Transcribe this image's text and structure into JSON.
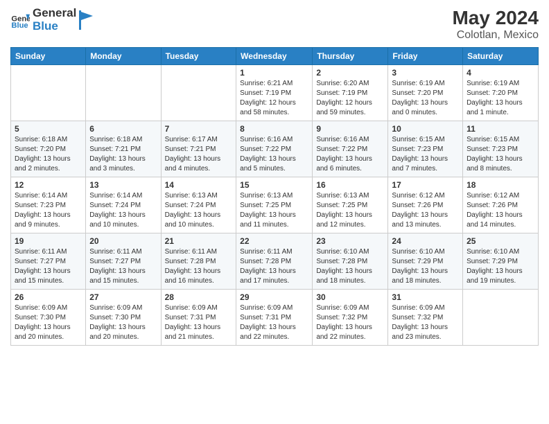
{
  "header": {
    "logo_general": "General",
    "logo_blue": "Blue",
    "month_year": "May 2024",
    "location": "Colotlan, Mexico"
  },
  "days_of_week": [
    "Sunday",
    "Monday",
    "Tuesday",
    "Wednesday",
    "Thursday",
    "Friday",
    "Saturday"
  ],
  "weeks": [
    [
      {
        "day": "",
        "info": ""
      },
      {
        "day": "",
        "info": ""
      },
      {
        "day": "",
        "info": ""
      },
      {
        "day": "1",
        "info": "Sunrise: 6:21 AM\nSunset: 7:19 PM\nDaylight: 12 hours and 58 minutes."
      },
      {
        "day": "2",
        "info": "Sunrise: 6:20 AM\nSunset: 7:19 PM\nDaylight: 12 hours and 59 minutes."
      },
      {
        "day": "3",
        "info": "Sunrise: 6:19 AM\nSunset: 7:20 PM\nDaylight: 13 hours and 0 minutes."
      },
      {
        "day": "4",
        "info": "Sunrise: 6:19 AM\nSunset: 7:20 PM\nDaylight: 13 hours and 1 minute."
      }
    ],
    [
      {
        "day": "5",
        "info": "Sunrise: 6:18 AM\nSunset: 7:20 PM\nDaylight: 13 hours and 2 minutes."
      },
      {
        "day": "6",
        "info": "Sunrise: 6:18 AM\nSunset: 7:21 PM\nDaylight: 13 hours and 3 minutes."
      },
      {
        "day": "7",
        "info": "Sunrise: 6:17 AM\nSunset: 7:21 PM\nDaylight: 13 hours and 4 minutes."
      },
      {
        "day": "8",
        "info": "Sunrise: 6:16 AM\nSunset: 7:22 PM\nDaylight: 13 hours and 5 minutes."
      },
      {
        "day": "9",
        "info": "Sunrise: 6:16 AM\nSunset: 7:22 PM\nDaylight: 13 hours and 6 minutes."
      },
      {
        "day": "10",
        "info": "Sunrise: 6:15 AM\nSunset: 7:23 PM\nDaylight: 13 hours and 7 minutes."
      },
      {
        "day": "11",
        "info": "Sunrise: 6:15 AM\nSunset: 7:23 PM\nDaylight: 13 hours and 8 minutes."
      }
    ],
    [
      {
        "day": "12",
        "info": "Sunrise: 6:14 AM\nSunset: 7:23 PM\nDaylight: 13 hours and 9 minutes."
      },
      {
        "day": "13",
        "info": "Sunrise: 6:14 AM\nSunset: 7:24 PM\nDaylight: 13 hours and 10 minutes."
      },
      {
        "day": "14",
        "info": "Sunrise: 6:13 AM\nSunset: 7:24 PM\nDaylight: 13 hours and 10 minutes."
      },
      {
        "day": "15",
        "info": "Sunrise: 6:13 AM\nSunset: 7:25 PM\nDaylight: 13 hours and 11 minutes."
      },
      {
        "day": "16",
        "info": "Sunrise: 6:13 AM\nSunset: 7:25 PM\nDaylight: 13 hours and 12 minutes."
      },
      {
        "day": "17",
        "info": "Sunrise: 6:12 AM\nSunset: 7:26 PM\nDaylight: 13 hours and 13 minutes."
      },
      {
        "day": "18",
        "info": "Sunrise: 6:12 AM\nSunset: 7:26 PM\nDaylight: 13 hours and 14 minutes."
      }
    ],
    [
      {
        "day": "19",
        "info": "Sunrise: 6:11 AM\nSunset: 7:27 PM\nDaylight: 13 hours and 15 minutes."
      },
      {
        "day": "20",
        "info": "Sunrise: 6:11 AM\nSunset: 7:27 PM\nDaylight: 13 hours and 15 minutes."
      },
      {
        "day": "21",
        "info": "Sunrise: 6:11 AM\nSunset: 7:28 PM\nDaylight: 13 hours and 16 minutes."
      },
      {
        "day": "22",
        "info": "Sunrise: 6:11 AM\nSunset: 7:28 PM\nDaylight: 13 hours and 17 minutes."
      },
      {
        "day": "23",
        "info": "Sunrise: 6:10 AM\nSunset: 7:28 PM\nDaylight: 13 hours and 18 minutes."
      },
      {
        "day": "24",
        "info": "Sunrise: 6:10 AM\nSunset: 7:29 PM\nDaylight: 13 hours and 18 minutes."
      },
      {
        "day": "25",
        "info": "Sunrise: 6:10 AM\nSunset: 7:29 PM\nDaylight: 13 hours and 19 minutes."
      }
    ],
    [
      {
        "day": "26",
        "info": "Sunrise: 6:09 AM\nSunset: 7:30 PM\nDaylight: 13 hours and 20 minutes."
      },
      {
        "day": "27",
        "info": "Sunrise: 6:09 AM\nSunset: 7:30 PM\nDaylight: 13 hours and 20 minutes."
      },
      {
        "day": "28",
        "info": "Sunrise: 6:09 AM\nSunset: 7:31 PM\nDaylight: 13 hours and 21 minutes."
      },
      {
        "day": "29",
        "info": "Sunrise: 6:09 AM\nSunset: 7:31 PM\nDaylight: 13 hours and 22 minutes."
      },
      {
        "day": "30",
        "info": "Sunrise: 6:09 AM\nSunset: 7:32 PM\nDaylight: 13 hours and 22 minutes."
      },
      {
        "day": "31",
        "info": "Sunrise: 6:09 AM\nSunset: 7:32 PM\nDaylight: 13 hours and 23 minutes."
      },
      {
        "day": "",
        "info": ""
      }
    ]
  ]
}
